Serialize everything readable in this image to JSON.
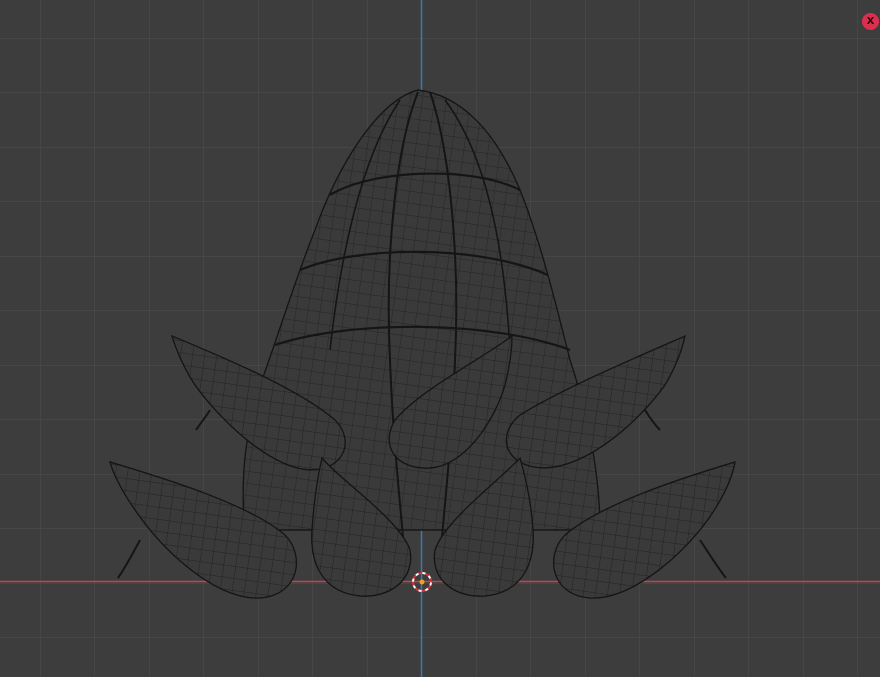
{
  "viewport": {
    "close_label": "X",
    "colors": {
      "background": "#3d3d3d",
      "grid": "#545454",
      "axis_x": "#c6424e",
      "axis_z": "#3a78b8",
      "mesh_fill": "#3a3a3a",
      "mesh_wire": "#1a1a1a",
      "cursor": "#f0a020"
    },
    "icons": {
      "close": "close-icon",
      "cursor": "3d-cursor-icon"
    }
  }
}
